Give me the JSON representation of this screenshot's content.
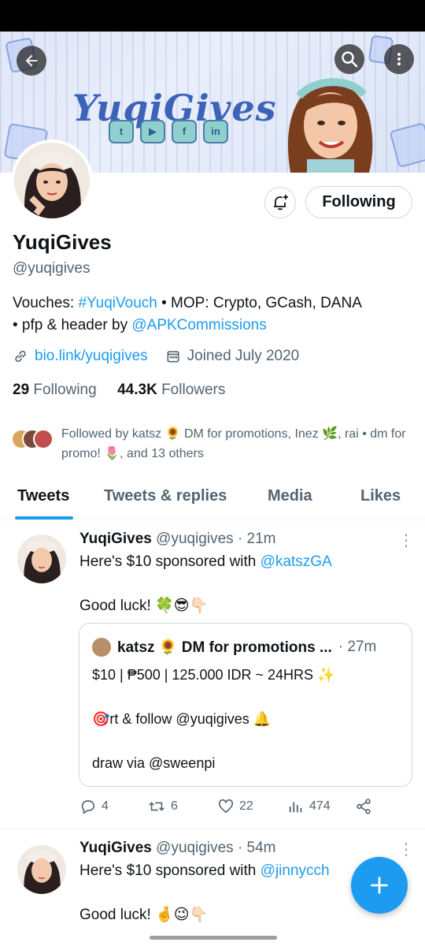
{
  "header": {
    "brand_text": "YuqiGives",
    "social_labels": [
      "t",
      "f",
      "▶",
      "f",
      "in"
    ]
  },
  "profile": {
    "follow_button": "Following",
    "name": "YuqiGives",
    "handle": "@yuqigives",
    "bio_line1_prefix": "Vouches: ",
    "bio_line1_link": "#YuqiVouch",
    "bio_line1_suffix": " • MOP: Crypto, GCash, DANA",
    "bio_line2_prefix": "• pfp & header by ",
    "bio_line2_link": "@APKCommissions",
    "website": "bio.link/yuqigives",
    "joined": "Joined July 2020",
    "following_count": "29",
    "following_label": "Following",
    "followers_count": "44.3K",
    "followers_label": "Followers",
    "followed_by": "Followed by katsz 🌻 DM for promotions, Inez 🌿, rai • dm for promo! 🌷, and 13 others"
  },
  "tabs": [
    "Tweets",
    "Tweets & replies",
    "Media",
    "Likes"
  ],
  "tweets": [
    {
      "name": "YuqiGives",
      "handle": "@yuqigives",
      "time": "· 21m",
      "text_prefix": "Here's $10 sponsored with ",
      "text_link": "@katszGA",
      "text2": "Good luck! 🍀😎👇🏻",
      "quote": {
        "name": "katsz 🌻 DM for promotions ...",
        "time": "· 27m",
        "line1": "$10 | ₱500 | 125.000 IDR  ~ 24HRS ✨",
        "line2": "🎯rt & follow @yuqigives 🔔",
        "line3": "draw via @sweenpi"
      },
      "replies": "4",
      "retweets": "6",
      "likes": "22",
      "views": "474"
    },
    {
      "name": "YuqiGives",
      "handle": "@yuqigives",
      "time": "· 54m",
      "text_prefix": "Here's $10 sponsored with ",
      "text_link": "@jinnycch",
      "text2": "Good luck! 🤞😉👇🏻"
    }
  ],
  "colors": {
    "accent": "#1d9bf0",
    "text": "#0f1419",
    "muted": "#536471"
  }
}
